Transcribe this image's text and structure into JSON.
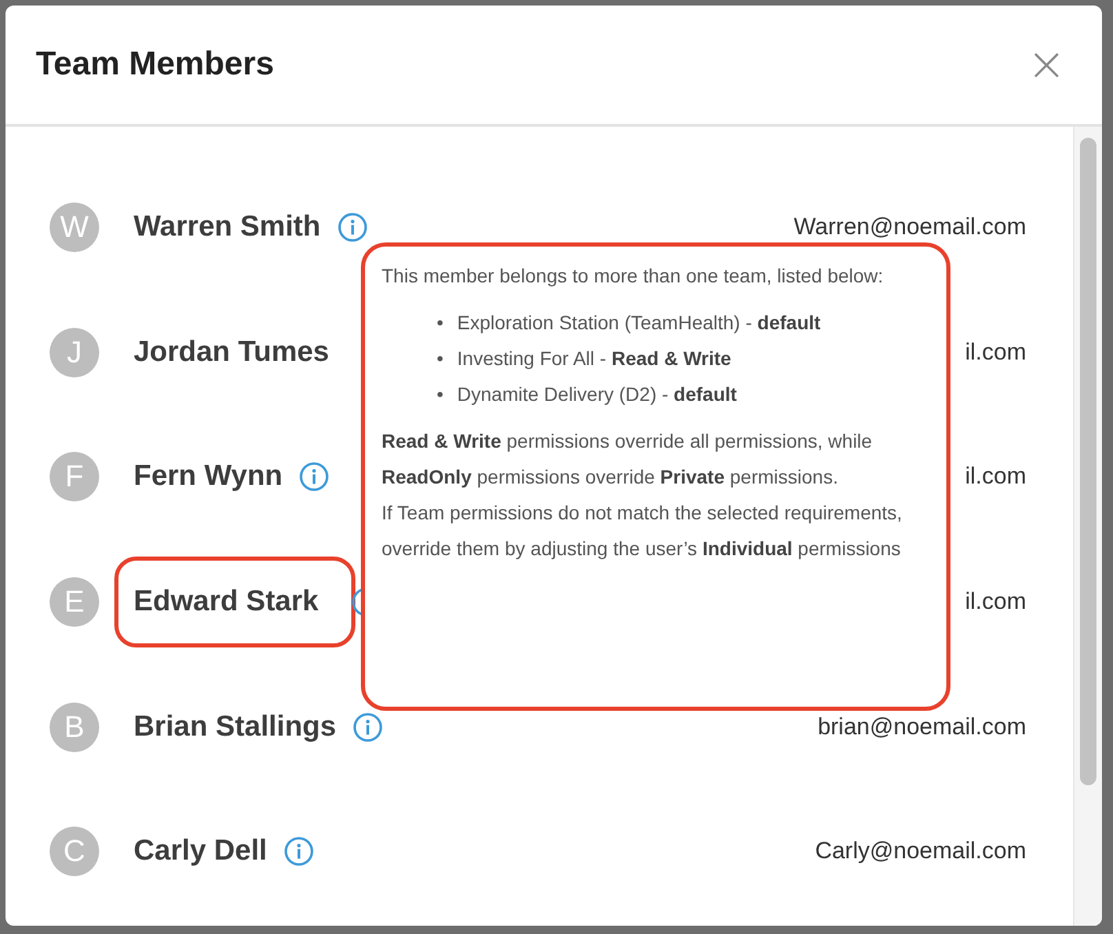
{
  "dialog": {
    "title": "Team Members",
    "close_label": "×"
  },
  "members": [
    {
      "initial": "W",
      "name": "Warren Smith",
      "info_icon": true,
      "email": "Warren@noemail.com",
      "highlighted": false
    },
    {
      "initial": "J",
      "name": "Jordan Tumes",
      "info_icon": false,
      "email": "il.com",
      "highlighted": false
    },
    {
      "initial": "F",
      "name": "Fern Wynn",
      "info_icon": true,
      "email": "il.com",
      "highlighted": false
    },
    {
      "initial": "E",
      "name": "Edward Stark",
      "info_icon": true,
      "email": "il.com",
      "highlighted": true
    },
    {
      "initial": "B",
      "name": "Brian Stallings",
      "info_icon": true,
      "email": "brian@noemail.com",
      "highlighted": false
    },
    {
      "initial": "C",
      "name": "Carly Dell",
      "info_icon": true,
      "email": "Carly@noemail.com",
      "highlighted": false
    }
  ],
  "tooltip": {
    "highlighted": true,
    "intro": "This member belongs to more than one team, listed below:",
    "teams": [
      {
        "bullet": "•",
        "text": "Exploration Station (TeamHealth) - **default**"
      },
      {
        "bullet": "•",
        "text": "Investing For All - **Read & Write**"
      },
      {
        "bullet": "•",
        "text": "Dynamite Delivery (D2) - **default**"
      }
    ],
    "paragraphs": [
      "**Read & Write** permissions override all permissions, while **ReadOnly** permissions override **Private** permissions.",
      "If Team permissions do not match the selected requirements, override them by adjusting the user’s **Individual** permissions"
    ]
  }
}
